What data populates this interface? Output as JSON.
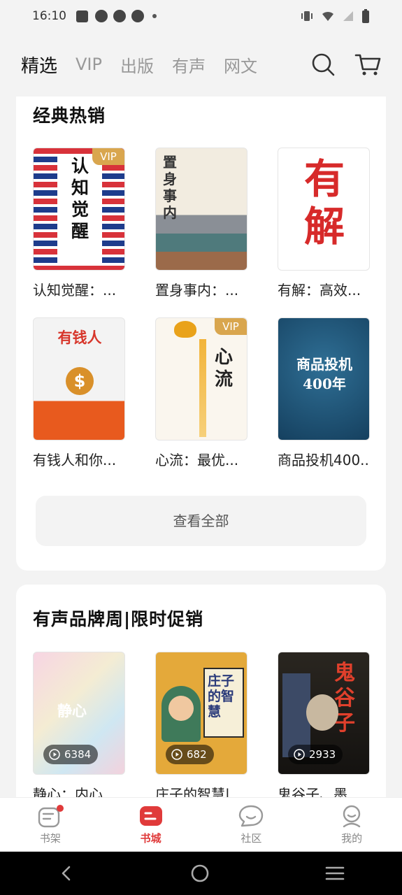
{
  "status": {
    "time": "16:10"
  },
  "nav": {
    "tabs": [
      "精选",
      "VIP",
      "出版",
      "有声",
      "网文"
    ],
    "active_index": 0
  },
  "section1": {
    "title": "经典热销",
    "books": [
      {
        "title": "认知觉醒：...",
        "vip": "VIP",
        "cover_text": "认知觉醒"
      },
      {
        "title": "置身事内：...",
        "vip": "",
        "cover_text": "置身事内"
      },
      {
        "title": "有解：高效...",
        "vip": "",
        "cover_text": "有解"
      },
      {
        "title": "有钱人和你...",
        "vip": "",
        "cover_text": "有钱人"
      },
      {
        "title": "心流：最优...",
        "vip": "VIP",
        "cover_text": "心流"
      },
      {
        "title": "商品投机400...",
        "vip": "",
        "cover_text": "商品投机400年"
      }
    ],
    "view_all": "查看全部"
  },
  "section2": {
    "title": "有声品牌周|限时促销",
    "books": [
      {
        "title": "静心：内心...",
        "plays": "6384",
        "cover_text": "静心"
      },
      {
        "title": "庄子的智慧|...",
        "plays": "682",
        "cover_text": "庄子的智慧"
      },
      {
        "title": "鬼谷子、墨...",
        "plays": "2933",
        "cover_text": "鬼谷子"
      }
    ]
  },
  "bottom_tabs": [
    "书架",
    "书城",
    "社区",
    "我的"
  ],
  "colors": {
    "accent": "#e03a3a",
    "vip": "#d9a64e"
  }
}
